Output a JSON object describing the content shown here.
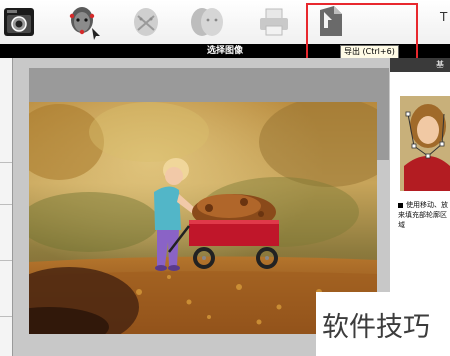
{
  "toolbar": {
    "items": [
      {
        "name": "camera-icon"
      },
      {
        "name": "face-select-icon"
      },
      {
        "name": "face-mask-icon"
      },
      {
        "name": "face-morph-icon"
      },
      {
        "name": "printer-icon"
      },
      {
        "name": "export-icon",
        "tooltip": "导出 (Ctrl+6)"
      }
    ],
    "more_label": "T"
  },
  "title_bar": {
    "title": "选择图像"
  },
  "right_panel": {
    "tab_label": "基本",
    "help_text": "使用移动、放来填充部轮廓区域"
  },
  "watermark": {
    "text": "软件技巧"
  },
  "colors": {
    "title_bar_bg": "#000000",
    "highlight_border": "#e8282e",
    "canvas_bg": "#c8c8c8",
    "wagon_red": "#c0162a"
  }
}
